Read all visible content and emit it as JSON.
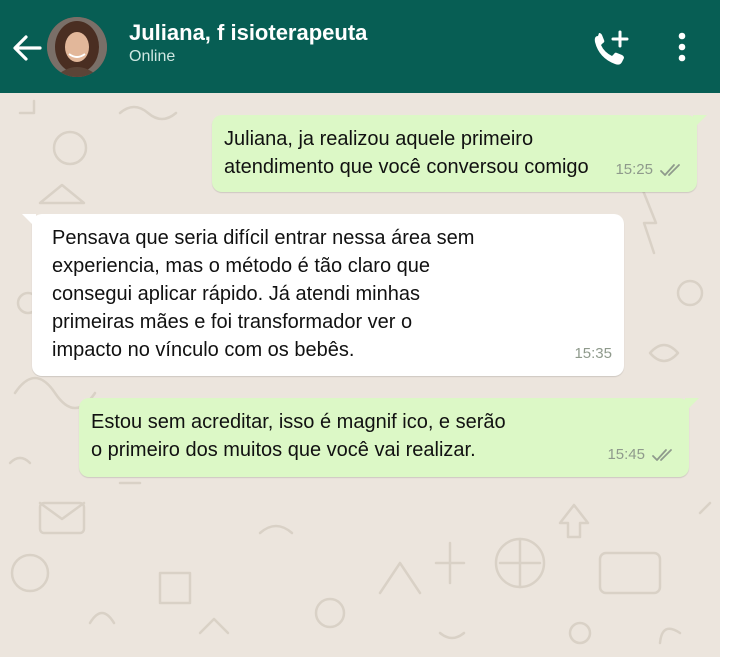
{
  "chat_header": {
    "contact_name": "Juliana, f isioterapeuta",
    "status": "Online"
  },
  "icons": {
    "back": "arrow-left-icon",
    "avatar": "profile-photo",
    "call": "add-call-icon",
    "menu": "more-vertical-icon",
    "read_receipt": "double-check-icon"
  },
  "colors": {
    "header": "#075e54",
    "outgoing_bubble": "#dcf8c6",
    "incoming_bubble": "#ffffff",
    "chat_background": "#ece5dd"
  },
  "messages": [
    {
      "direction": "outgoing",
      "lines": [
        "Juliana, ja realizou aquele primeiro",
        " atendimento que você conversou comigo"
      ],
      "time": "15:25",
      "read": true
    },
    {
      "direction": "incoming",
      "lines": [
        "Pensava que seria difícil entrar nessa área sem",
        "experiencia, mas o método é tão claro que",
        "consegui aplicar rápido. Já atendi minhas",
        " primeiras mães e foi transformador ver o",
        " impacto no vínculo com os bebês."
      ],
      "time": "15:35"
    },
    {
      "direction": "outgoing",
      "lines": [
        "Estou sem acreditar, isso é magnif ico, e serão",
        "o primeiro dos muitos que você vai realizar."
      ],
      "time": "15:45",
      "read": true
    }
  ]
}
